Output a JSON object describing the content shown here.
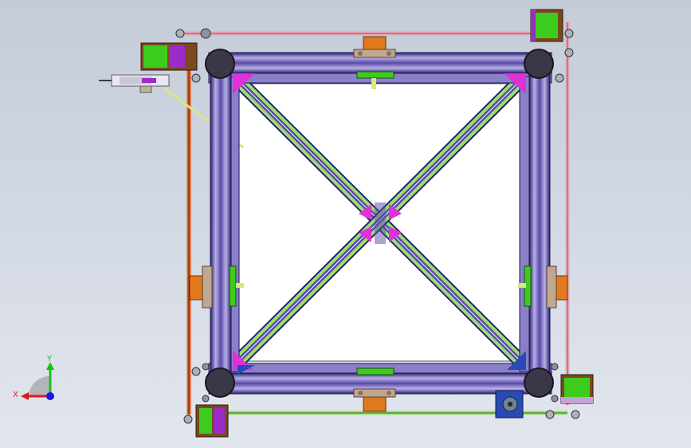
{
  "viewport": {
    "background_top": "#c4ccd8",
    "background_bottom": "#e2e6ee"
  },
  "colors": {
    "frame_purple": "#5a4aa8",
    "frame_light": "#b8b0e8",
    "frame_dark": "#2a2070",
    "motor_green": "#3ccc1e",
    "motor_purple": "#9a2cc8",
    "motor_brown": "#7a4a1e",
    "bracket_orange": "#e07a1c",
    "gusset_magenta": "#e030d8",
    "rod_green": "#9ae070",
    "rod_pink": "#e8a8b8",
    "belt_orange": "#e05a1c",
    "corner_dark": "#3a3848",
    "panel_white": "#ffffff",
    "gear_blue": "#2a4ab8"
  },
  "triad": {
    "x_label": "X",
    "y_label": "Y",
    "x_color": "#e01818",
    "y_color": "#18c018",
    "z_color": "#1818e0"
  }
}
